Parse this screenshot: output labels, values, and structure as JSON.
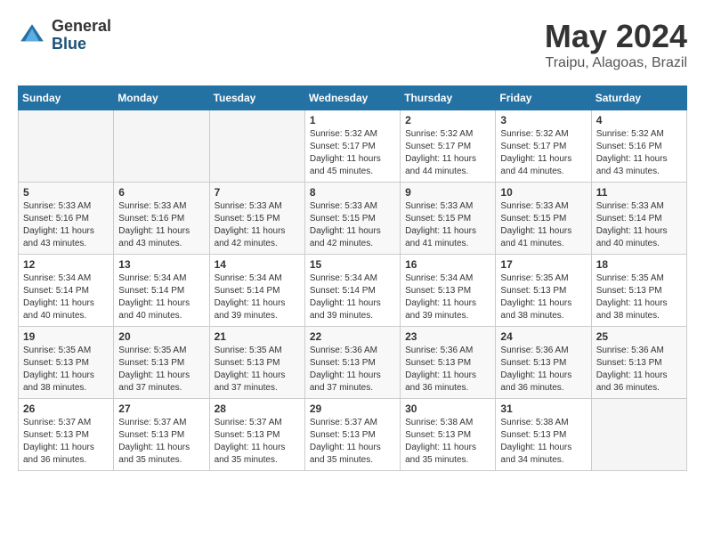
{
  "header": {
    "logo_general": "General",
    "logo_blue": "Blue",
    "title": "May 2024",
    "subtitle": "Traipu, Alagoas, Brazil"
  },
  "days_of_week": [
    "Sunday",
    "Monday",
    "Tuesday",
    "Wednesday",
    "Thursday",
    "Friday",
    "Saturday"
  ],
  "weeks": [
    [
      {
        "day": "",
        "info": ""
      },
      {
        "day": "",
        "info": ""
      },
      {
        "day": "",
        "info": ""
      },
      {
        "day": "1",
        "info": "Sunrise: 5:32 AM\nSunset: 5:17 PM\nDaylight: 11 hours\nand 45 minutes."
      },
      {
        "day": "2",
        "info": "Sunrise: 5:32 AM\nSunset: 5:17 PM\nDaylight: 11 hours\nand 44 minutes."
      },
      {
        "day": "3",
        "info": "Sunrise: 5:32 AM\nSunset: 5:17 PM\nDaylight: 11 hours\nand 44 minutes."
      },
      {
        "day": "4",
        "info": "Sunrise: 5:32 AM\nSunset: 5:16 PM\nDaylight: 11 hours\nand 43 minutes."
      }
    ],
    [
      {
        "day": "5",
        "info": "Sunrise: 5:33 AM\nSunset: 5:16 PM\nDaylight: 11 hours\nand 43 minutes."
      },
      {
        "day": "6",
        "info": "Sunrise: 5:33 AM\nSunset: 5:16 PM\nDaylight: 11 hours\nand 43 minutes."
      },
      {
        "day": "7",
        "info": "Sunrise: 5:33 AM\nSunset: 5:15 PM\nDaylight: 11 hours\nand 42 minutes."
      },
      {
        "day": "8",
        "info": "Sunrise: 5:33 AM\nSunset: 5:15 PM\nDaylight: 11 hours\nand 42 minutes."
      },
      {
        "day": "9",
        "info": "Sunrise: 5:33 AM\nSunset: 5:15 PM\nDaylight: 11 hours\nand 41 minutes."
      },
      {
        "day": "10",
        "info": "Sunrise: 5:33 AM\nSunset: 5:15 PM\nDaylight: 11 hours\nand 41 minutes."
      },
      {
        "day": "11",
        "info": "Sunrise: 5:33 AM\nSunset: 5:14 PM\nDaylight: 11 hours\nand 40 minutes."
      }
    ],
    [
      {
        "day": "12",
        "info": "Sunrise: 5:34 AM\nSunset: 5:14 PM\nDaylight: 11 hours\nand 40 minutes."
      },
      {
        "day": "13",
        "info": "Sunrise: 5:34 AM\nSunset: 5:14 PM\nDaylight: 11 hours\nand 40 minutes."
      },
      {
        "day": "14",
        "info": "Sunrise: 5:34 AM\nSunset: 5:14 PM\nDaylight: 11 hours\nand 39 minutes."
      },
      {
        "day": "15",
        "info": "Sunrise: 5:34 AM\nSunset: 5:14 PM\nDaylight: 11 hours\nand 39 minutes."
      },
      {
        "day": "16",
        "info": "Sunrise: 5:34 AM\nSunset: 5:13 PM\nDaylight: 11 hours\nand 39 minutes."
      },
      {
        "day": "17",
        "info": "Sunrise: 5:35 AM\nSunset: 5:13 PM\nDaylight: 11 hours\nand 38 minutes."
      },
      {
        "day": "18",
        "info": "Sunrise: 5:35 AM\nSunset: 5:13 PM\nDaylight: 11 hours\nand 38 minutes."
      }
    ],
    [
      {
        "day": "19",
        "info": "Sunrise: 5:35 AM\nSunset: 5:13 PM\nDaylight: 11 hours\nand 38 minutes."
      },
      {
        "day": "20",
        "info": "Sunrise: 5:35 AM\nSunset: 5:13 PM\nDaylight: 11 hours\nand 37 minutes."
      },
      {
        "day": "21",
        "info": "Sunrise: 5:35 AM\nSunset: 5:13 PM\nDaylight: 11 hours\nand 37 minutes."
      },
      {
        "day": "22",
        "info": "Sunrise: 5:36 AM\nSunset: 5:13 PM\nDaylight: 11 hours\nand 37 minutes."
      },
      {
        "day": "23",
        "info": "Sunrise: 5:36 AM\nSunset: 5:13 PM\nDaylight: 11 hours\nand 36 minutes."
      },
      {
        "day": "24",
        "info": "Sunrise: 5:36 AM\nSunset: 5:13 PM\nDaylight: 11 hours\nand 36 minutes."
      },
      {
        "day": "25",
        "info": "Sunrise: 5:36 AM\nSunset: 5:13 PM\nDaylight: 11 hours\nand 36 minutes."
      }
    ],
    [
      {
        "day": "26",
        "info": "Sunrise: 5:37 AM\nSunset: 5:13 PM\nDaylight: 11 hours\nand 36 minutes."
      },
      {
        "day": "27",
        "info": "Sunrise: 5:37 AM\nSunset: 5:13 PM\nDaylight: 11 hours\nand 35 minutes."
      },
      {
        "day": "28",
        "info": "Sunrise: 5:37 AM\nSunset: 5:13 PM\nDaylight: 11 hours\nand 35 minutes."
      },
      {
        "day": "29",
        "info": "Sunrise: 5:37 AM\nSunset: 5:13 PM\nDaylight: 11 hours\nand 35 minutes."
      },
      {
        "day": "30",
        "info": "Sunrise: 5:38 AM\nSunset: 5:13 PM\nDaylight: 11 hours\nand 35 minutes."
      },
      {
        "day": "31",
        "info": "Sunrise: 5:38 AM\nSunset: 5:13 PM\nDaylight: 11 hours\nand 34 minutes."
      },
      {
        "day": "",
        "info": ""
      }
    ]
  ]
}
